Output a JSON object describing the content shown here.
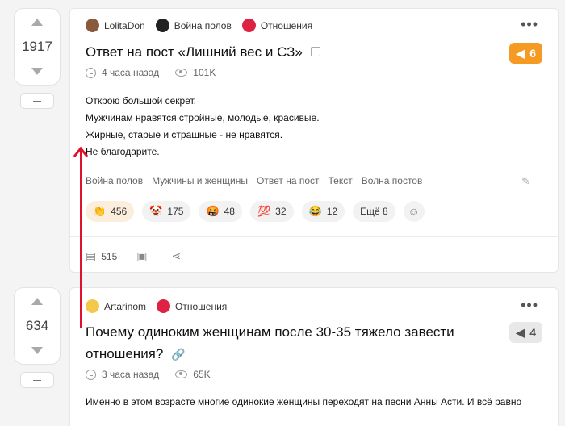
{
  "posts": [
    {
      "rating": "1917",
      "author": "LolitaDon",
      "community1": "Война полов",
      "community2": "Отношения",
      "title": "Ответ на пост «Лишний вес и СЗ»",
      "badge": "6",
      "time": "4 часа назад",
      "views": "101K",
      "body": [
        "Открою большой секрет.",
        "Мужчинам нравятся стройные, молодые, красивые.",
        "Жирные, старые и страшные - не нравятся.",
        "Не благодарите."
      ],
      "tags": [
        "Война полов",
        "Мужчины и женщины",
        "Ответ на пост",
        "Текст",
        "Волна постов"
      ],
      "reactions": [
        {
          "emoji": "👏",
          "count": "456"
        },
        {
          "emoji": "🤡",
          "count": "175"
        },
        {
          "emoji": "🤬",
          "count": "48"
        },
        {
          "emoji": "💯",
          "count": "32"
        },
        {
          "emoji": "😂",
          "count": "12"
        }
      ],
      "more_label": "Ещё 8",
      "comments": "515"
    },
    {
      "rating": "634",
      "author": "Artarinom",
      "community1": "Отношения",
      "title_line1": "Почему одиноким женщинам после 30-35 тяжело завести",
      "title_line2": "отношения?",
      "badge": "4",
      "time": "3 часа назад",
      "views": "65K",
      "body": "Именно в этом возрасте многие одинокие женщины переходят на песни Анны Асти. И всё равно"
    }
  ],
  "colors": {
    "accent_orange": "#f59a22",
    "red_arrow": "#e0112b"
  }
}
